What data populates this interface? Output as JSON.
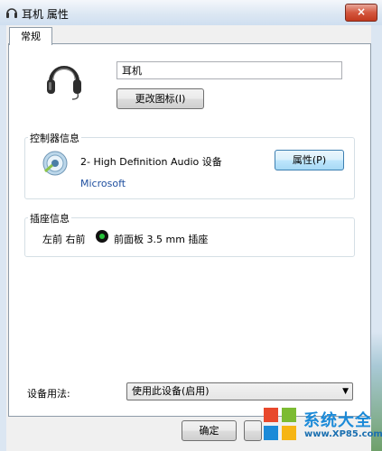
{
  "window": {
    "title": "耳机 属性",
    "close_glyph": "×"
  },
  "tabs": [
    {
      "label": "常规"
    }
  ],
  "device": {
    "name_value": "耳机",
    "change_icon_label": "更改图标(I)"
  },
  "controller": {
    "group_title": "控制器信息",
    "device_name": "2- High Definition Audio 设备",
    "vendor": "Microsoft",
    "properties_label": "属性(P)"
  },
  "jack": {
    "group_title": "插座信息",
    "location": "左前 右前",
    "description": "前面板 3.5 mm 插座",
    "jack_color": "#27c33b"
  },
  "usage": {
    "label": "设备用法:",
    "selected": "使用此设备(启用)"
  },
  "footer": {
    "ok_label": "确定"
  },
  "watermark": {
    "brand": "系统大全",
    "site": "www.XP85.com"
  },
  "icons": {
    "title": "headphone-icon",
    "device": "headphone-icon",
    "controller": "speaker-audio-icon",
    "dropdown": "chevron-down-icon"
  }
}
